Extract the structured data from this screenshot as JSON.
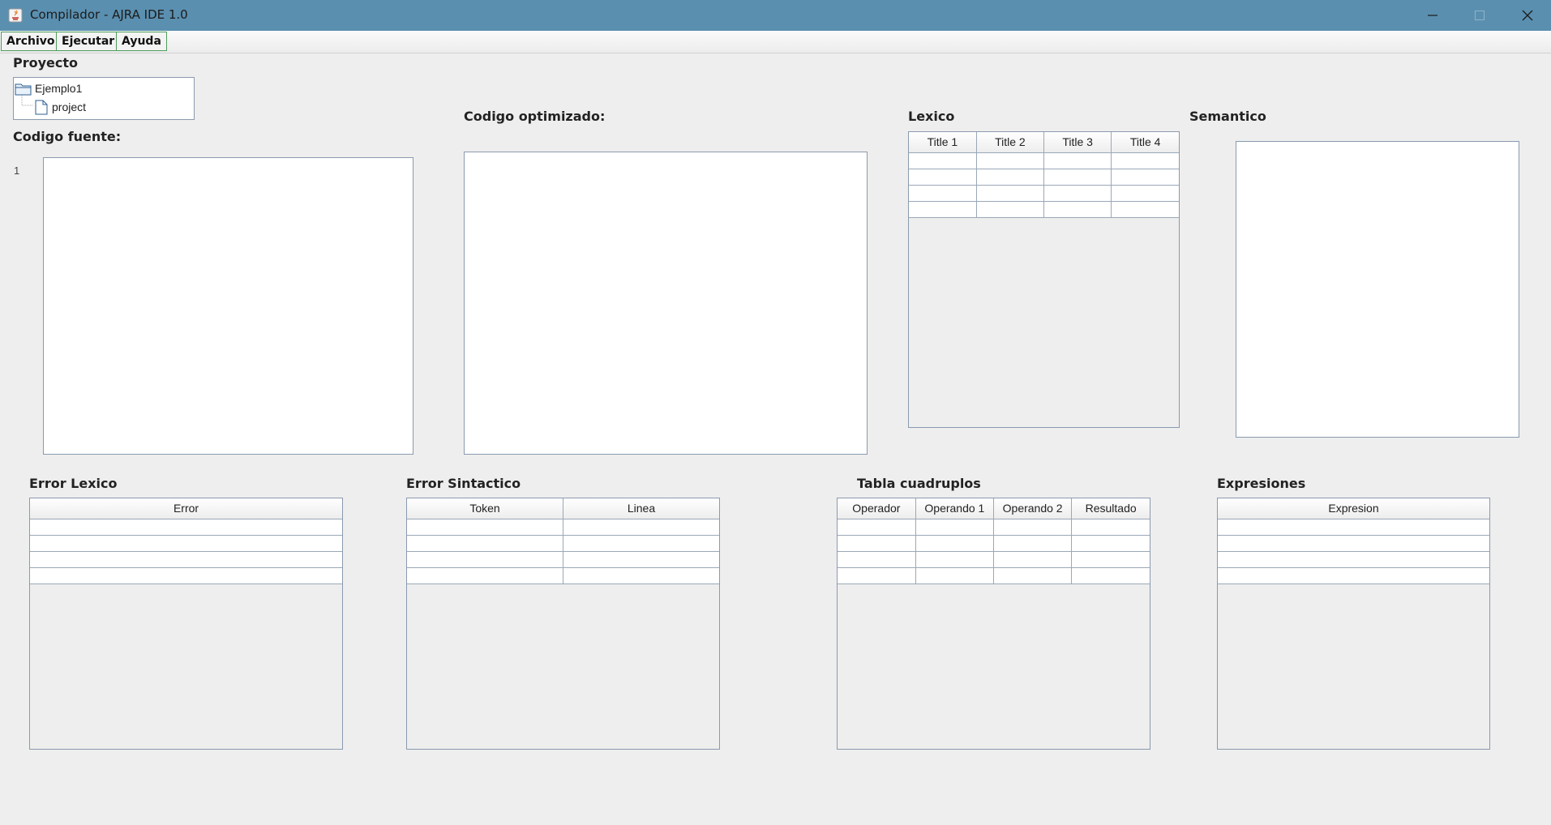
{
  "window": {
    "title": "Compilador - AJRA IDE 1.0"
  },
  "menu": [
    "Archivo",
    "Ejecutar",
    "Ayuda"
  ],
  "project": {
    "heading": "Proyecto",
    "root": "Ejemplo1",
    "child": "project"
  },
  "source": {
    "heading": "Codigo fuente:",
    "line_number": "1"
  },
  "optimized": {
    "heading": "Codigo optimizado:"
  },
  "lexico": {
    "heading": "Lexico",
    "columns": [
      "Title 1",
      "Title 2",
      "Title 3",
      "Title 4"
    ]
  },
  "semantico": {
    "heading": "Semantico"
  },
  "error_lexico": {
    "heading": "Error Lexico",
    "columns": [
      "Error"
    ]
  },
  "error_sintactico": {
    "heading": "Error Sintactico",
    "columns": [
      "Token",
      "Linea"
    ]
  },
  "cuadruplos": {
    "heading": "Tabla cuadruplos",
    "columns": [
      "Operador",
      "Operando 1",
      "Operando 2",
      "Resultado"
    ]
  },
  "expresiones": {
    "heading": "Expresiones",
    "columns": [
      "Expresion"
    ]
  },
  "colors": {
    "titlebar": "#5a8faf",
    "menu_border": "#4e9c5a",
    "panel_border": "#8a9aae"
  }
}
